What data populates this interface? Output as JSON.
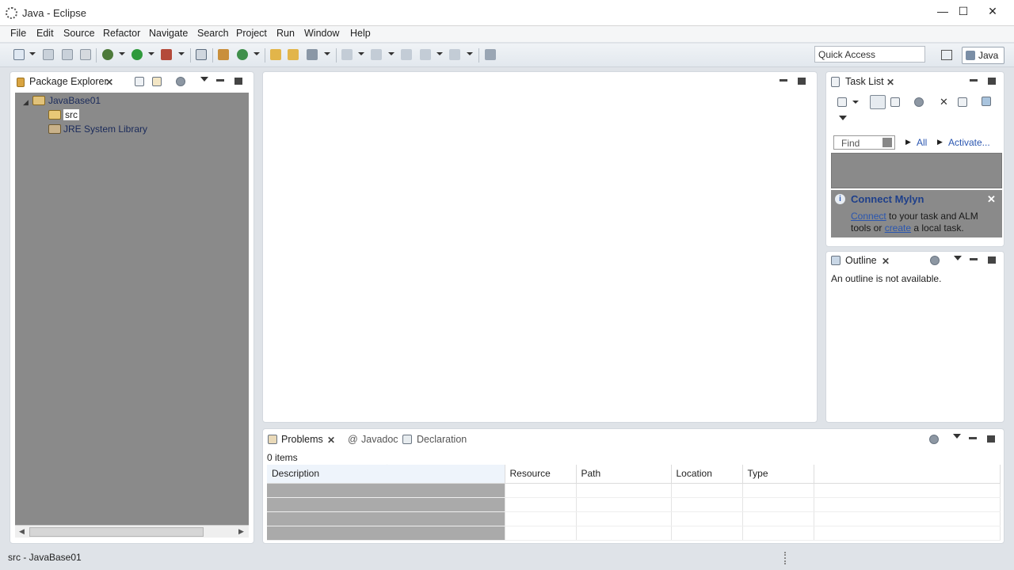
{
  "window": {
    "title": "Java - Eclipse",
    "controls": {
      "minimize": "—",
      "maximize": "☐",
      "close": "✕"
    }
  },
  "menu": [
    "File",
    "Edit",
    "Source",
    "Refactor",
    "Navigate",
    "Search",
    "Project",
    "Run",
    "Window",
    "Help"
  ],
  "toolbar": {
    "quick_access": "Quick Access",
    "perspective": "Java"
  },
  "package_explorer": {
    "tab_label": "Package Explorer",
    "tree": {
      "project": "JavaBase01",
      "children": [
        "src",
        "JRE System Library"
      ]
    }
  },
  "task_list": {
    "tab_label": "Task List",
    "find_placeholder": "Find",
    "filter_all": "All",
    "activate": "Activate...",
    "mylyn": {
      "title": "Connect Mylyn",
      "connect": "Connect",
      "line1_rest": " to your task and ALM",
      "line2_start": "tools or ",
      "create": "create",
      "line2_rest": " a local task."
    }
  },
  "outline": {
    "tab_label": "Outline",
    "message": "An outline is not available."
  },
  "bottom": {
    "tabs": [
      "Problems",
      "Javadoc",
      "Declaration"
    ],
    "count": "0 items",
    "columns": [
      "Description",
      "Resource",
      "Path",
      "Location",
      "Type"
    ],
    "row_count_visible": 4
  },
  "status": {
    "text": "src - JavaBase01"
  },
  "colors": {
    "accent_link": "#2a56b0",
    "chrome_bg": "#dfe3e8",
    "mylyn_bg": "#8a8a8a"
  }
}
